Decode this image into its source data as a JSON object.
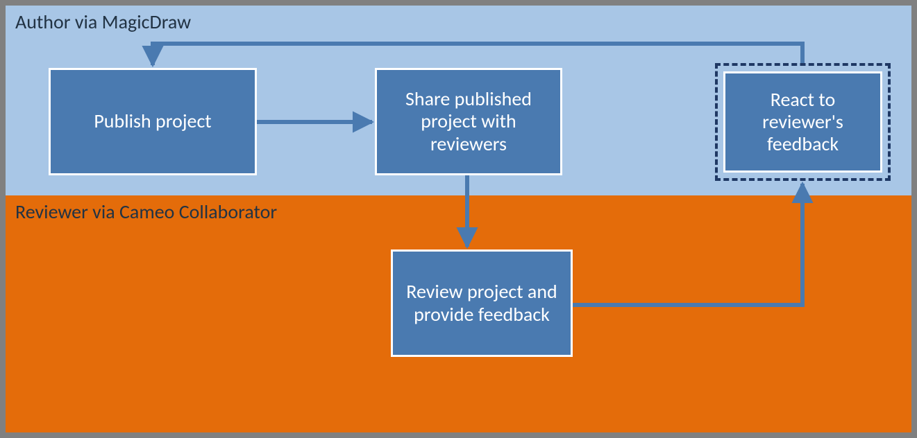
{
  "lanes": {
    "author": {
      "label": "Author via MagicDraw"
    },
    "reviewer": {
      "label": "Reviewer via Cameo Collaborator"
    }
  },
  "nodes": {
    "publish": {
      "label": "Publish project"
    },
    "share": {
      "label": "Share published project with reviewers"
    },
    "review": {
      "label": "Review project and provide feedback"
    },
    "react": {
      "label": "React to reviewer's feedback"
    }
  },
  "colors": {
    "laneAuthor": "#a8c6e6",
    "laneReviewer": "#e46c0a",
    "nodeFill": "#4a7ab0",
    "nodeBorder": "#ffffff",
    "arrow": "#4a7ab0",
    "dashed": "#1f3864",
    "outerBorder": "#808080"
  }
}
